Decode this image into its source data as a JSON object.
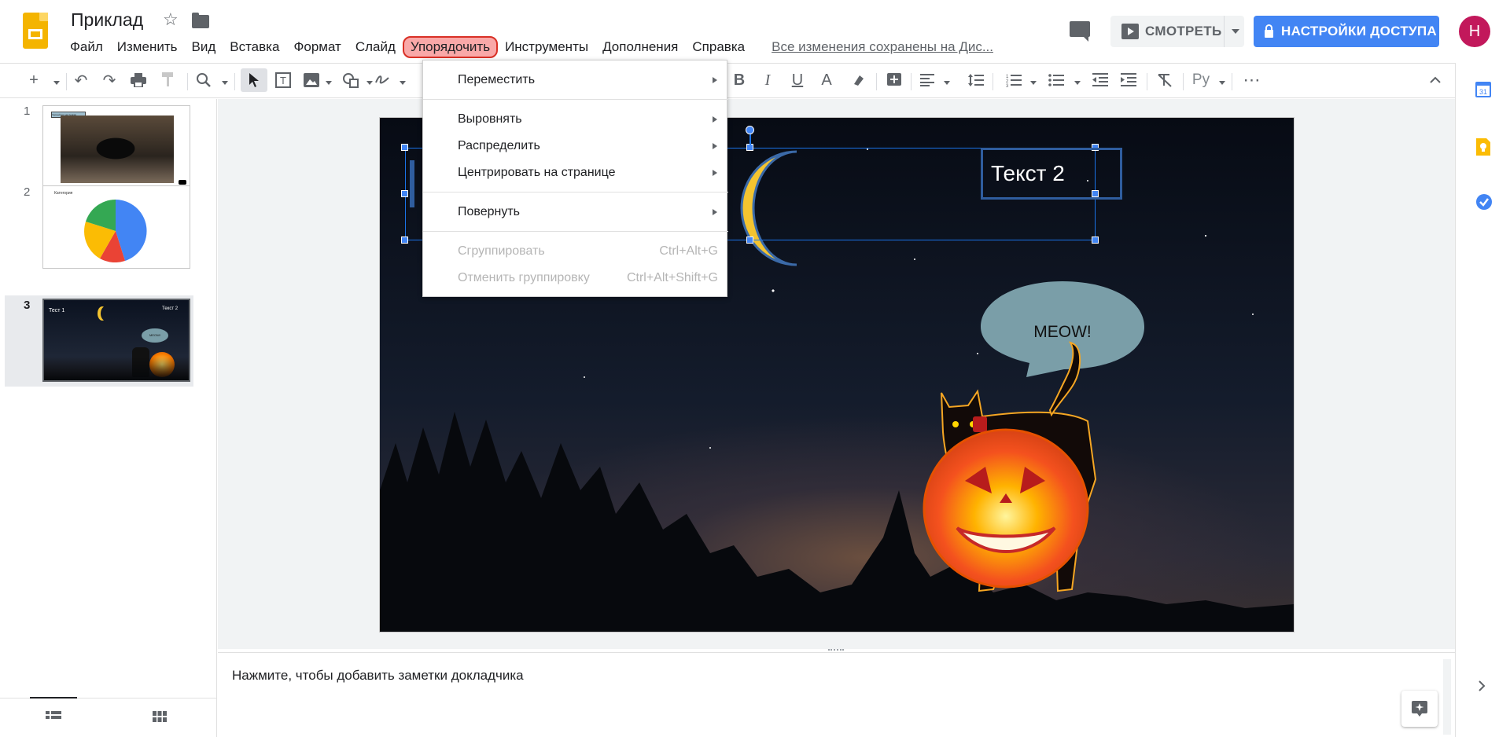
{
  "app": {
    "doc_title": "Приклад",
    "saved_status": "Все изменения сохранены на Дис..."
  },
  "menu": [
    "Файл",
    "Изменить",
    "Вид",
    "Вставка",
    "Формат",
    "Слайд",
    "Упорядочить",
    "Инструменты",
    "Дополнения",
    "Справка"
  ],
  "menu_active_index": 6,
  "header_buttons": {
    "watch": "СМОТРЕТЬ",
    "share": "НАСТРОЙКИ ДОСТУПА",
    "avatar_letter": "Н"
  },
  "toolbar": {
    "language_label": "Ру"
  },
  "filmstrip": {
    "slides": [
      {
        "number": "1",
        "title_chip": "Черный кот на пушках"
      },
      {
        "number": "2",
        "title_chip": "Категория"
      },
      {
        "number": "3",
        "title_chip": "Тест 1",
        "second_text": "Текст 2",
        "bubble": "MEOW!"
      }
    ],
    "selected_index": 2
  },
  "slide": {
    "text_box": "Текст 2",
    "bubble_text": "MEOW!"
  },
  "notes": {
    "placeholder": "Нажмите, чтобы добавить заметки докладчика"
  },
  "arrange_menu": {
    "groups": [
      [
        {
          "label": "Переместить",
          "submenu": true
        }
      ],
      [
        {
          "label": "Выровнять",
          "submenu": true
        },
        {
          "label": "Распределить",
          "submenu": true
        },
        {
          "label": "Центрировать на странице",
          "submenu": true
        }
      ],
      [
        {
          "label": "Повернуть",
          "submenu": true
        }
      ],
      [
        {
          "label": "Сгруппировать",
          "shortcut": "Ctrl+Alt+G",
          "disabled": true
        },
        {
          "label": "Отменить группировку",
          "shortcut": "Ctrl+Alt+Shift+G",
          "disabled": true
        }
      ]
    ]
  },
  "side_panel_icons": [
    "calendar-icon",
    "keep-icon",
    "tasks-icon"
  ],
  "colors": {
    "accent": "#4285f4",
    "avatar": "#c2185b",
    "menu_highlight": "#f9a8a8",
    "moon": "#f4c430",
    "bubble": "#7a9ea8"
  }
}
